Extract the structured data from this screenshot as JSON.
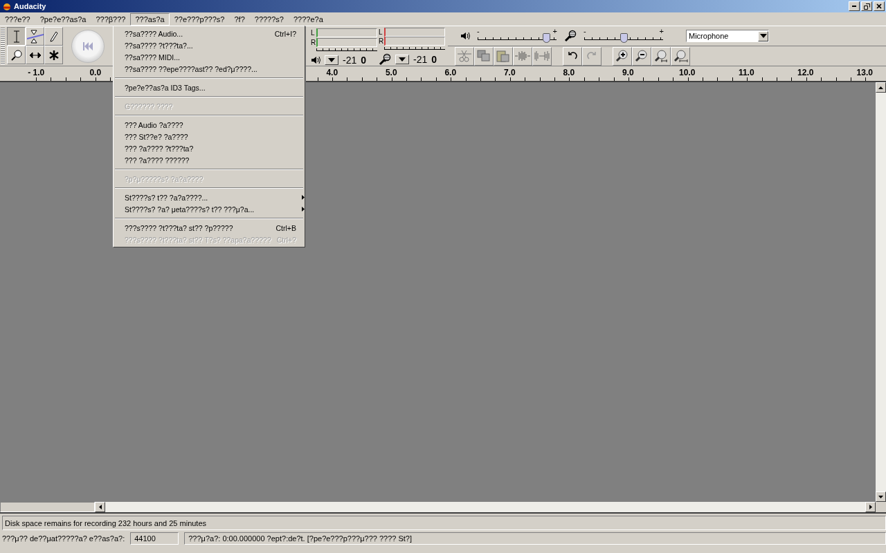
{
  "window": {
    "title": "Audacity"
  },
  "menu_bar": [
    {
      "label": "???e??",
      "selected": false
    },
    {
      "label": "?pe?e??as?a",
      "selected": false
    },
    {
      "label": "???β???",
      "selected": false
    },
    {
      "label": "???as?a",
      "selected": true
    },
    {
      "label": "??e???p???s?",
      "selected": false
    },
    {
      "label": "?f?",
      "selected": false
    },
    {
      "label": "?????s?",
      "selected": false
    },
    {
      "label": "????e?a",
      "selected": false
    }
  ],
  "open_menu": {
    "items": [
      {
        "kind": "item",
        "label": "??sa???? Audio...",
        "shortcut": "Ctrl+I?",
        "disabled": false
      },
      {
        "kind": "item",
        "label": "??sa???? ?t???ta?...",
        "disabled": false
      },
      {
        "kind": "item",
        "label": "??sa???? MIDI...",
        "disabled": false
      },
      {
        "kind": "item",
        "label": "??sa???? ??epe????ast?? ?ed?μ????...",
        "disabled": false
      },
      {
        "kind": "separator"
      },
      {
        "kind": "item",
        "label": "?pe?e??as?a ID3 Tags...",
        "disabled": false
      },
      {
        "kind": "separator"
      },
      {
        "kind": "item",
        "label": "G?????? ????",
        "disabled": true
      },
      {
        "kind": "separator"
      },
      {
        "kind": "item",
        "label": "??? Audio  ?a????",
        "disabled": false
      },
      {
        "kind": "item",
        "label": "??? St??e? ?a????",
        "disabled": false
      },
      {
        "kind": "item",
        "label": "??? ?a???? ?t???ta?",
        "disabled": false
      },
      {
        "kind": "item",
        "label": "??? ?a???? ??????",
        "disabled": false
      },
      {
        "kind": "separator"
      },
      {
        "kind": "item",
        "label": "?p?μ?????s? ?a?a????",
        "disabled": true
      },
      {
        "kind": "separator"
      },
      {
        "kind": "submenu",
        "label": "St????s? t?? ?a?a????...",
        "disabled": false
      },
      {
        "kind": "submenu",
        "label": "St????s? ?a? μeta????s? t?? ???μ?a...",
        "disabled": false
      },
      {
        "kind": "separator"
      },
      {
        "kind": "item",
        "label": "???s???? ?t???ta? st?? ?p?????",
        "shortcut": "Ctrl+B",
        "disabled": false
      },
      {
        "kind": "item",
        "label": "???s???? ?t???ta? st?? T?s? ??apa?a?????",
        "shortcut": "Ctrl+?",
        "disabled": true
      }
    ]
  },
  "tools": [
    {
      "kind": "select",
      "selected": true
    },
    {
      "kind": "envelope",
      "selected": false
    },
    {
      "kind": "draw",
      "selected": false
    },
    {
      "kind": "zoom",
      "selected": false
    },
    {
      "kind": "timeshift",
      "selected": false
    },
    {
      "kind": "multi",
      "selected": false
    }
  ],
  "meters": [
    {
      "kind": "playback",
      "left": "L",
      "right": "R",
      "scale": [
        "-21",
        "0"
      ]
    },
    {
      "kind": "record",
      "left": "L",
      "right": "R",
      "scale": [
        "-21",
        "0"
      ]
    }
  ],
  "mixer": {
    "sliders": [
      {
        "kind": "output",
        "min_label": "-",
        "max_label": "+",
        "level": 0.87
      },
      {
        "kind": "input",
        "min_label": "-",
        "max_label": "+",
        "level": 0.5
      }
    ],
    "input_source": "Microphone"
  },
  "edit_tools": [
    {
      "kind": "cut"
    },
    {
      "kind": "copy"
    },
    {
      "kind": "paste"
    },
    {
      "kind": "trim"
    },
    {
      "kind": "silence"
    },
    {
      "kind": "undo"
    },
    {
      "kind": "redo"
    },
    {
      "kind": "zoom_in"
    },
    {
      "kind": "zoom_out"
    },
    {
      "kind": "fit_selection"
    },
    {
      "kind": "fit_project"
    }
  ],
  "ruler": {
    "left_labels": [
      "- 1.0",
      "0.0"
    ],
    "right_labels": [
      "4.0",
      "5.0",
      "6.0",
      "7.0",
      "8.0",
      "9.0",
      "10.0",
      "11.0",
      "12.0",
      "13.0"
    ]
  },
  "status": {
    "message": "Disk space remains for recording 232 hours and 25 minutes",
    "rate_label": "???μ?? de??μat?????a? e??as?a?:",
    "rate": "44100",
    "selection": "???μ?a?: 0:00.000000 ?ept?:de?t.  [?pe?e???p???μ??? ???? St?]"
  }
}
